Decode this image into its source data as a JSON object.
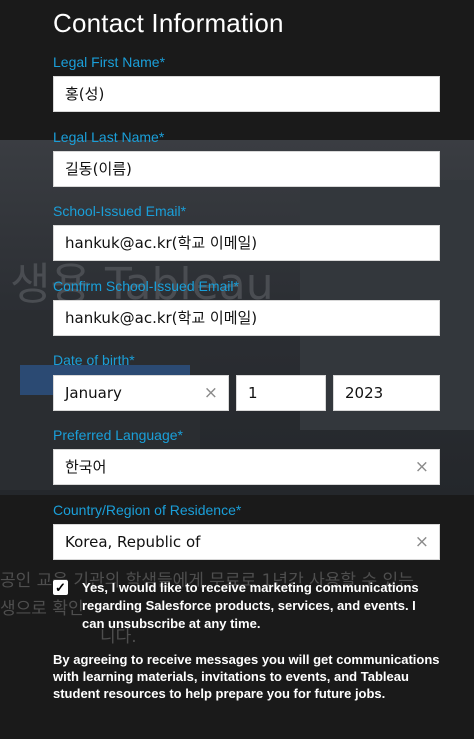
{
  "background": {
    "heading": "생용 Tableau",
    "line1": "공인 교육 기관의 학생들에게 무료로 1년간 사용할 수 있는",
    "line2": "생으로 확인",
    "line3": "니다."
  },
  "form": {
    "title": "Contact Information",
    "first_name": {
      "label": "Legal First Name*",
      "value": "홍(성)"
    },
    "last_name": {
      "label": "Legal Last Name*",
      "value": "길동(이름)"
    },
    "email": {
      "label": "School-Issued Email*",
      "value": "hankuk@ac.kr(학교 이메일)"
    },
    "confirm_email": {
      "label": "Confirm School-Issued Email*",
      "value": "hankuk@ac.kr(학교 이메일)"
    },
    "dob": {
      "label": "Date of birth*",
      "month": "January",
      "day": "1",
      "year": "2023"
    },
    "language": {
      "label": "Preferred Language*",
      "value": "한국어"
    },
    "country": {
      "label": "Country/Region of Residence*",
      "value": "Korea, Republic of"
    },
    "marketing_checked": "✓",
    "marketing_text": "Yes, I would like to receive marketing communications regarding Salesforce products, services, and events. I can unsubscribe at any time.",
    "agreement_text": "By agreeing to receive messages you will get communications with learning materials, invitations to events, and Tableau student resources to help prepare you for future jobs.",
    "clear_icon": "×"
  },
  "colors": {
    "label": "#1a9fd9",
    "overlay_bg": "#1a1a1a"
  }
}
